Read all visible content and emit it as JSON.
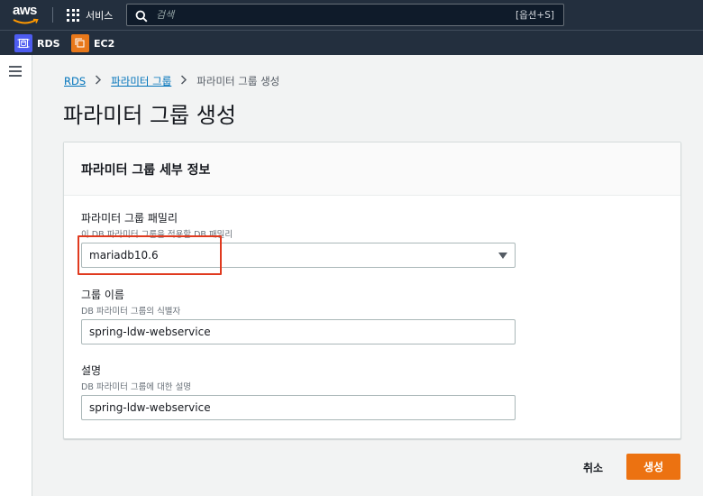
{
  "topnav": {
    "logo_text": "aws",
    "services_label": "서비스",
    "search": {
      "placeholder": "검색",
      "shortcut": "[옵션+S]"
    }
  },
  "favorites": [
    {
      "label": "RDS",
      "icon": "rds-icon",
      "color": "#4d5cf0"
    },
    {
      "label": "EC2",
      "icon": "ec2-icon",
      "color": "#e8781a"
    }
  ],
  "breadcrumb": {
    "items": [
      "RDS",
      "파라미터 그룹"
    ],
    "current": "파라미터 그룹 생성"
  },
  "page": {
    "title": "파라미터 그룹 생성"
  },
  "panel": {
    "title": "파라미터 그룹 세부 정보",
    "fields": {
      "family": {
        "label": "파라미터 그룹 패밀리",
        "description": "이 DB 파라미터 그룹을 적용할 DB 패밀리",
        "value": "mariadb10.6"
      },
      "name": {
        "label": "그룹 이름",
        "description": "DB 파라미터 그룹의 식별자",
        "value": "spring-ldw-webservice"
      },
      "description": {
        "label": "설명",
        "description": "DB 파라미터 그룹에 대한 설명",
        "value": "spring-ldw-webservice"
      }
    }
  },
  "actions": {
    "cancel": "취소",
    "create": "생성"
  },
  "colors": {
    "nav_bg": "#232f3e",
    "primary": "#ec7211",
    "link": "#0073bb",
    "highlight": "#e03a1f"
  }
}
